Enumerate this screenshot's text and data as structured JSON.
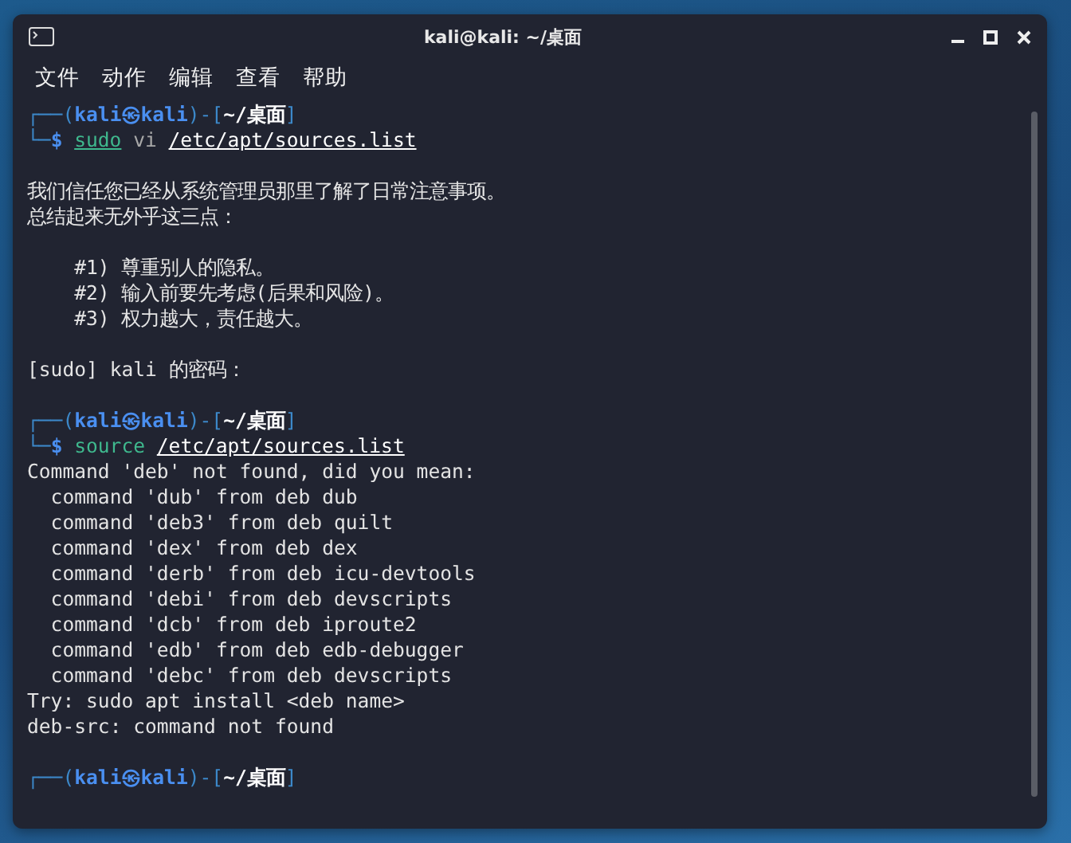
{
  "window": {
    "title": "kali@kali: ~/桌面",
    "controls": [
      {
        "kind": "minimize"
      },
      {
        "kind": "maximize"
      },
      {
        "kind": "close"
      }
    ]
  },
  "menu": [
    "文件",
    "动作",
    "编辑",
    "查看",
    "帮助"
  ],
  "terminal": {
    "lines": [
      {
        "kind": "prompt",
        "segments": [
          {
            "text": "┌──(",
            "kind": "frame"
          },
          {
            "text": "kali㉿kali",
            "kind": "user"
          },
          {
            "text": ")-[",
            "kind": "frame"
          },
          {
            "text": "~/桌面",
            "kind": "dir"
          },
          {
            "text": "]",
            "kind": "frame"
          }
        ]
      },
      {
        "kind": "prompt",
        "segments": [
          {
            "text": "└─",
            "kind": "frame"
          },
          {
            "text": "$",
            "kind": "dollar"
          },
          {
            "text": "sudo",
            "kind": "command",
            "underlined": true
          },
          {
            "text": "vi",
            "kind": "argument",
            "underlined": false
          },
          {
            "text": "/etc/apt/sources.list",
            "kind": "path",
            "underlined": true
          }
        ]
      },
      {
        "kind": "blank"
      },
      {
        "kind": "output",
        "text": "我们信任您已经从系统管理员那里了解了日常注意事项。"
      },
      {
        "kind": "output",
        "text": "总结起来无外乎这三点："
      },
      {
        "kind": "blank"
      },
      {
        "kind": "output",
        "text": "    #1) 尊重别人的隐私。"
      },
      {
        "kind": "output",
        "text": "    #2) 输入前要先考虑(后果和风险)。"
      },
      {
        "kind": "output",
        "text": "    #3) 权力越大，责任越大。"
      },
      {
        "kind": "blank"
      },
      {
        "kind": "output",
        "text": "[sudo] kali 的密码："
      },
      {
        "kind": "blank"
      },
      {
        "kind": "prompt",
        "segments": [
          {
            "text": "┌──(",
            "kind": "frame"
          },
          {
            "text": "kali㉿kali",
            "kind": "user"
          },
          {
            "text": ")-[",
            "kind": "frame"
          },
          {
            "text": "~/桌面",
            "kind": "dir"
          },
          {
            "text": "]",
            "kind": "frame"
          }
        ]
      },
      {
        "kind": "prompt",
        "segments": [
          {
            "text": "└─",
            "kind": "frame"
          },
          {
            "text": "$",
            "kind": "dollar"
          },
          {
            "text": "source",
            "kind": "command",
            "underlined": false
          },
          {
            "text": "/etc/apt/sources.list",
            "kind": "path",
            "underlined": true
          }
        ]
      },
      {
        "kind": "output",
        "text": "Command 'deb' not found, did you mean:"
      },
      {
        "kind": "output",
        "text": "  command 'dub' from deb dub"
      },
      {
        "kind": "output",
        "text": "  command 'deb3' from deb quilt"
      },
      {
        "kind": "output",
        "text": "  command 'dex' from deb dex"
      },
      {
        "kind": "output",
        "text": "  command 'derb' from deb icu-devtools"
      },
      {
        "kind": "output",
        "text": "  command 'debi' from deb devscripts"
      },
      {
        "kind": "output",
        "text": "  command 'dcb' from deb iproute2"
      },
      {
        "kind": "output",
        "text": "  command 'edb' from deb edb-debugger"
      },
      {
        "kind": "output",
        "text": "  command 'debc' from deb devscripts"
      },
      {
        "kind": "output",
        "text": "Try: sudo apt install <deb name>"
      },
      {
        "kind": "output",
        "text": "deb-src: command not found"
      },
      {
        "kind": "blank"
      },
      {
        "kind": "prompt",
        "segments": [
          {
            "text": "┌──(",
            "kind": "frame"
          },
          {
            "text": "kali㉿kali",
            "kind": "user"
          },
          {
            "text": ")-[",
            "kind": "frame"
          },
          {
            "text": "~/桌面",
            "kind": "dir"
          },
          {
            "text": "]",
            "kind": "frame"
          }
        ]
      }
    ]
  }
}
